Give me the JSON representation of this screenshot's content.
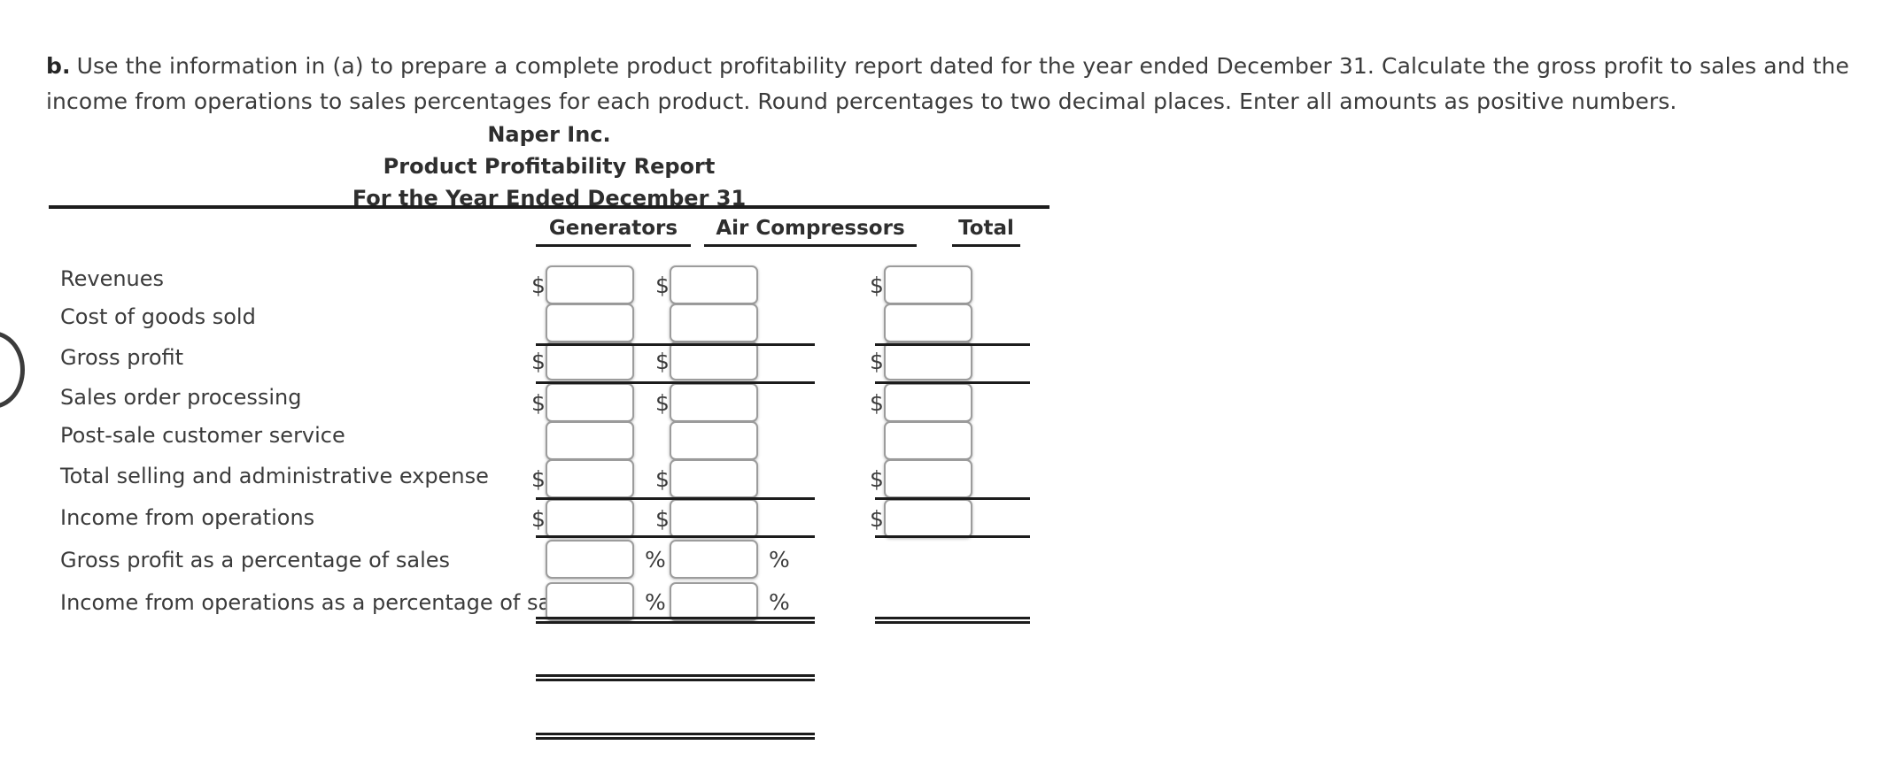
{
  "prompt": {
    "letter": "b.",
    "text": "Use the information in (a) to prepare a complete product profitability report dated for the year ended December 31. Calculate the gross profit to sales and the income from operations to sales percentages for each product. Round percentages to two decimal places. Enter all amounts as positive numbers."
  },
  "report": {
    "title_line1": "Naper Inc.",
    "title_line2": "Product Profitability Report",
    "title_line3": "For the Year Ended December 31",
    "columns": [
      {
        "key": "generators",
        "label": "Generators"
      },
      {
        "key": "compressors",
        "label": "Air Compressors"
      },
      {
        "key": "total",
        "label": "Total"
      }
    ],
    "rows": [
      {
        "key": "revenues",
        "label": "Revenues",
        "cells": [
          {
            "prefix": "$",
            "suffix": "",
            "value": ""
          },
          {
            "prefix": "$",
            "suffix": "",
            "value": ""
          },
          {
            "prefix": "$",
            "suffix": "",
            "value": ""
          }
        ]
      },
      {
        "key": "cost-of-goods-sold",
        "label": "Cost of goods sold",
        "cells": [
          {
            "prefix": "",
            "suffix": "",
            "value": ""
          },
          {
            "prefix": "",
            "suffix": "",
            "value": ""
          },
          {
            "prefix": "",
            "suffix": "",
            "value": ""
          }
        ]
      },
      {
        "key": "gross-profit",
        "label": "Gross profit",
        "cells": [
          {
            "prefix": "$",
            "suffix": "",
            "value": ""
          },
          {
            "prefix": "$",
            "suffix": "",
            "value": ""
          },
          {
            "prefix": "$",
            "suffix": "",
            "value": ""
          }
        ]
      },
      {
        "key": "sales-order-processing",
        "label": "Sales order processing",
        "cells": [
          {
            "prefix": "$",
            "suffix": "",
            "value": ""
          },
          {
            "prefix": "$",
            "suffix": "",
            "value": ""
          },
          {
            "prefix": "$",
            "suffix": "",
            "value": ""
          }
        ]
      },
      {
        "key": "post-sale-customer-service",
        "label": "Post-sale customer service",
        "cells": [
          {
            "prefix": "",
            "suffix": "",
            "value": ""
          },
          {
            "prefix": "",
            "suffix": "",
            "value": ""
          },
          {
            "prefix": "",
            "suffix": "",
            "value": ""
          }
        ]
      },
      {
        "key": "total-selling-and-administrative-expense",
        "label": "Total selling and administrative expense",
        "cells": [
          {
            "prefix": "$",
            "suffix": "",
            "value": ""
          },
          {
            "prefix": "$",
            "suffix": "",
            "value": ""
          },
          {
            "prefix": "$",
            "suffix": "",
            "value": ""
          }
        ]
      },
      {
        "key": "income-from-operations",
        "label": "Income from operations",
        "cells": [
          {
            "prefix": "$",
            "suffix": "",
            "value": ""
          },
          {
            "prefix": "$",
            "suffix": "",
            "value": ""
          },
          {
            "prefix": "$",
            "suffix": "",
            "value": ""
          }
        ]
      },
      {
        "key": "gross-profit-percentage-of-sales",
        "label": "Gross profit as a percentage of sales",
        "cells": [
          {
            "prefix": "",
            "suffix": "%",
            "value": ""
          },
          {
            "prefix": "",
            "suffix": "%",
            "value": ""
          }
        ]
      },
      {
        "key": "income-from-operations-percentage-of-sales",
        "label": "Income from operations as a percentage of sales",
        "cells": [
          {
            "prefix": "",
            "suffix": "%",
            "value": ""
          },
          {
            "prefix": "",
            "suffix": "%",
            "value": ""
          }
        ]
      }
    ]
  },
  "colors": {
    "text": "#3b3b3b",
    "rule": "#1c1c1c",
    "input_border": "#9c9c9c",
    "background": "#ffffff"
  }
}
